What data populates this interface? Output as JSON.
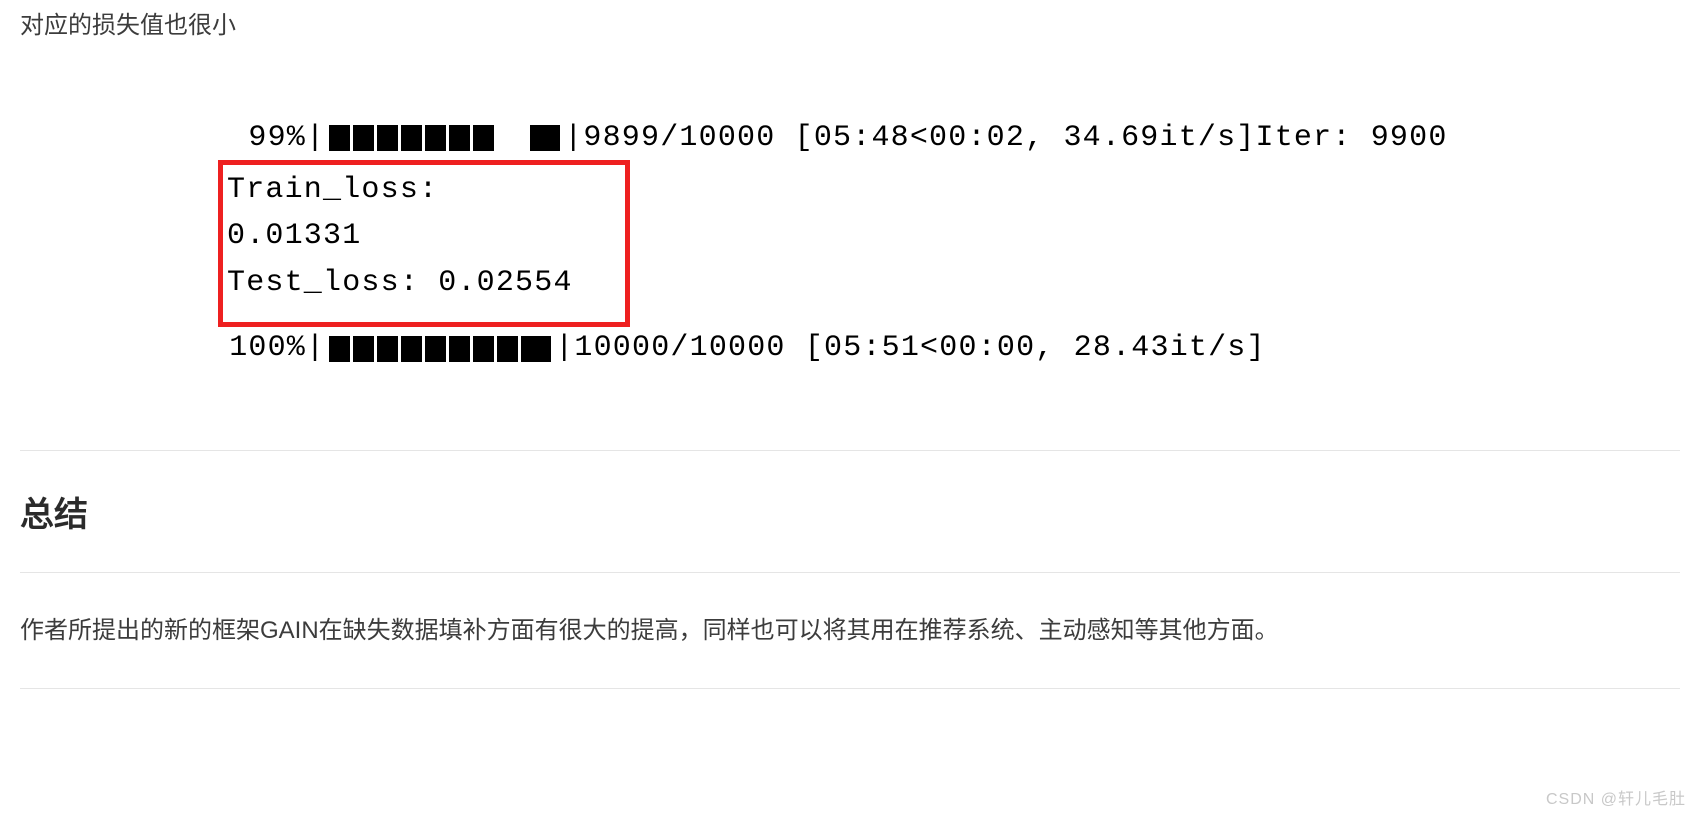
{
  "para1": "对应的损失值也很小",
  "progress1": {
    "pct": "99%",
    "open": "|",
    "close": "|",
    "stats": " 9899/10000 [05:48<00:02, 34.69it/s]Iter: 9900"
  },
  "redbox": {
    "line1": "Train_loss: 0.01331",
    "line2": "Test_loss: 0.02554"
  },
  "progress2": {
    "pct": "100%",
    "open": "|",
    "close": "|",
    "stats": " 10000/10000 [05:51<00:00, 28.43it/s]"
  },
  "sectionTitle": "总结",
  "para2": "作者所提出的新的框架GAIN在缺失数据填补方面有很大的提高，同样也可以将其用在推荐系统、主动感知等其他方面。",
  "watermark": "CSDN @轩儿毛肚"
}
